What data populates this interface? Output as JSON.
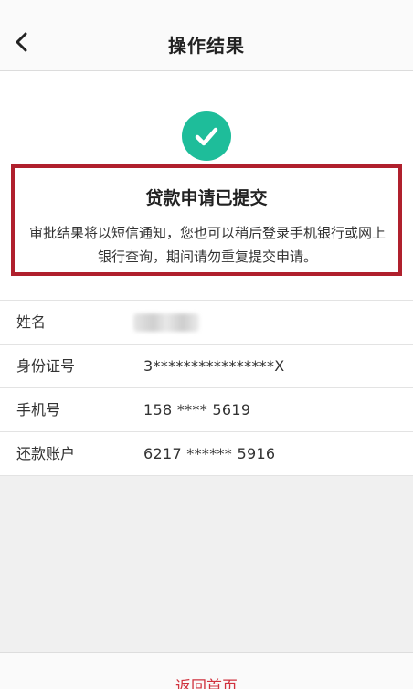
{
  "header": {
    "title": "操作结果"
  },
  "result": {
    "title": "贷款申请已提交",
    "description": "审批结果将以短信通知，您也可以稍后登录手机银行或网上银行查询，期间请勿重复提交申请。"
  },
  "info": {
    "rows": [
      {
        "label": "姓名",
        "value": ""
      },
      {
        "label": "身份证号",
        "value": "3****************X"
      },
      {
        "label": "手机号",
        "value": "158 **** 5619"
      },
      {
        "label": "还款账户",
        "value": "6217 ****** 5916"
      }
    ]
  },
  "footer": {
    "home_label": "返回首页"
  },
  "colors": {
    "success": "#1ebd9a",
    "highlight_border": "#b0202d",
    "link": "#d0323e"
  }
}
